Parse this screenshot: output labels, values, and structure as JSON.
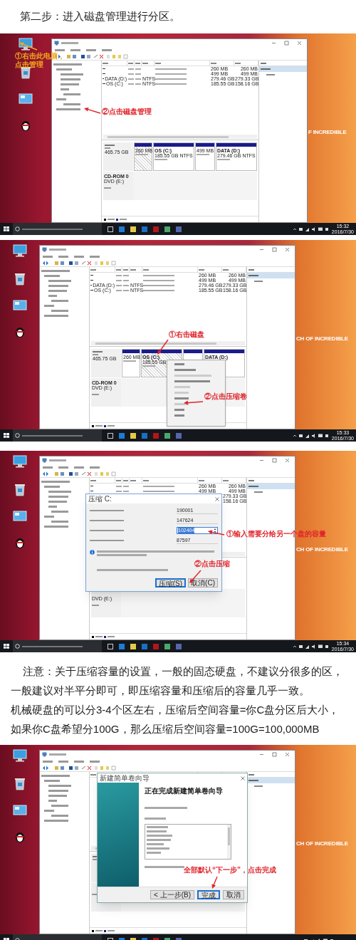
{
  "blocks": [
    {
      "kind": "heading",
      "text": "第二步：进入磁盘管理进行分区。"
    },
    {
      "kind": "disk-management",
      "desktop_caption": "F INCREDIBLE",
      "volumes": [
        {
          "capacity": "260 MB",
          "free": "260 MB"
        },
        {
          "capacity": "499 MB",
          "free": "499 MB"
        },
        {
          "name": "DATA (D:)",
          "fs": "NTFS",
          "capacity": "279.46 GB",
          "free": "279.33 GB"
        },
        {
          "name": "OS (C:)",
          "fs": "NTFS",
          "capacity": "185.55 GB",
          "free": "158.16 GB"
        }
      ],
      "disk0": {
        "size": "465.75 GB",
        "partitions": [
          {
            "size": "260 MB",
            "selected": true
          },
          {
            "name": "OS (C:)",
            "size": "185.55 GB NTFS",
            "selected": false
          },
          {
            "size": "499 MB",
            "selected": false
          },
          {
            "name": "DATA (D:)",
            "size": "279.46 GB NTFS",
            "selected": false
          }
        ]
      },
      "cdrom": {
        "name": "CD-ROM 0",
        "drive": "DVD (E:)"
      },
      "annotations": [
        {
          "text": "①右击此电脑，点击管理",
          "color": "#f2a91c"
        },
        {
          "text": "②点击磁盘管理",
          "color": "#e0242b"
        }
      ],
      "clock": {
        "time": "15:32",
        "date": "2016/7/30"
      }
    },
    {
      "kind": "context-menu",
      "desktop_caption": "CH OF INCREDIBLE",
      "volumes": [
        {
          "capacity": "260 MB",
          "free": "260 MB"
        },
        {
          "capacity": "499 MB",
          "free": "499 MB"
        },
        {
          "name": "DATA (D:)",
          "fs": "NTFS",
          "capacity": "279.46 GB",
          "free": "279.33 GB"
        },
        {
          "name": "OS (C:)",
          "fs": "NTFS",
          "capacity": "185.55 GB",
          "free": "158.16 GB"
        }
      ],
      "disk0": {
        "size": "465.75 GB",
        "partitions": [
          {
            "size": "260 MB",
            "selected": false
          },
          {
            "name": "OS (C:)",
            "size": "185.55 GB",
            "selected": true
          },
          {
            "selected": false
          },
          {
            "name": "DATA (D:)",
            "selected": false
          }
        ]
      },
      "cdrom": {
        "name": "CD-ROM 0",
        "drive": "DVD (E:)"
      },
      "annotations": [
        {
          "text": "①右击磁盘",
          "color": "#e0242b"
        },
        {
          "text": "②点击压缩卷",
          "color": "#e0242b"
        }
      ],
      "clock": {
        "time": "15:33",
        "date": "2016/7/30"
      }
    },
    {
      "kind": "shrink-dialog",
      "desktop_caption": "CH OF INCREDIBLE",
      "volumes": [
        {
          "capacity": "260 MB",
          "free": "260 MB"
        },
        {
          "capacity": "499 MB",
          "free": "499 MB"
        },
        {
          "free": "279.33 GB"
        },
        {
          "free": "158.16 GB"
        }
      ],
      "cdrom": {
        "drive": "DVD (E:)"
      },
      "dialog": {
        "title": "压缩 C:",
        "fields": [
          {
            "kind": "readout",
            "value": "190001"
          },
          {
            "kind": "readout",
            "value": "147624"
          },
          {
            "kind": "input",
            "value": "102404",
            "selected": true
          },
          {
            "kind": "readout",
            "value": "87597"
          }
        ],
        "buttons": [
          {
            "label": "压缩(S)",
            "default": true
          },
          {
            "label": "取消(C)",
            "default": false
          }
        ]
      },
      "annotations": [
        {
          "text": "①输入需要分给另一个盘的容量",
          "color": "#e0242b"
        },
        {
          "text": "②点击压缩",
          "color": "#e0242b"
        }
      ],
      "clock": {
        "time": "15:34",
        "date": "2016/7/30"
      }
    },
    {
      "kind": "note",
      "paragraphs": [
        {
          "text": "注意：关于压缩容量的设置，一般的固态硬盘，不建议分很多的区，一般建议对半平分即可，即压缩容量和压缩后的容量几乎一致。",
          "indent": true
        },
        {
          "text": "机械硬盘的可以分3-4个区左右，压缩后空间容量=你C盘分区后大小，如果你C盘希望分100G，那么压缩后空间容量=100G=100,000MB",
          "indent": false
        }
      ]
    },
    {
      "kind": "wizard",
      "desktop_caption": "CH OF INCREDIBLE",
      "dialog": {
        "title": "新建简单卷向导",
        "heading": "正在完成新建简单卷向导",
        "buttons": [
          {
            "label": "< 上一步(B)",
            "default": false
          },
          {
            "label": "完成",
            "default": true
          },
          {
            "label": "取消",
            "default": false
          }
        ]
      },
      "annotations": [
        {
          "text": "全部默认“下一步”，点击完成",
          "color": "#e0242b"
        }
      ]
    }
  ]
}
